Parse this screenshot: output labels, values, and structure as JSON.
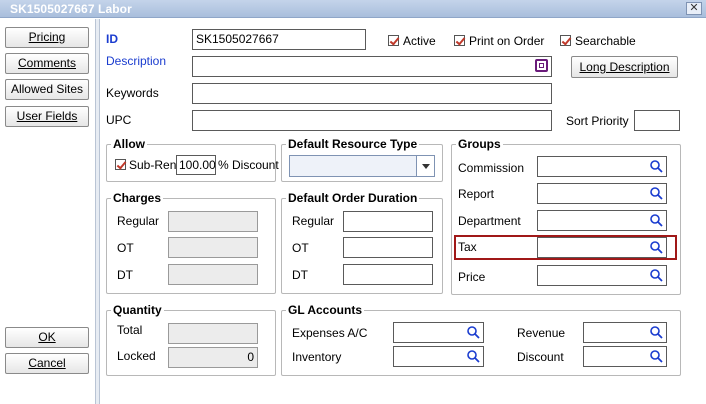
{
  "window": {
    "title": "SK1505027667 Labor",
    "close_glyph": "✕"
  },
  "sidebar": {
    "pricing": "Pricing",
    "comments": "Comments",
    "allowed_sites": "Allowed Sites",
    "user_fields": "User Fields",
    "ok": "OK",
    "cancel": "Cancel"
  },
  "header": {
    "id_label": "ID",
    "id_value": "SK1505027667",
    "active_label": "Active",
    "print_on_order_label": "Print on Order",
    "searchable_label": "Searchable",
    "description_label": "Description",
    "description_value": "",
    "long_description_button": "Long Description",
    "keywords_label": "Keywords",
    "upc_label": "UPC",
    "sort_priority_label": "Sort Priority"
  },
  "allow": {
    "title": "Allow",
    "sub_rent_label": "Sub-Rent",
    "discount_value": "100.00",
    "discount_label": "% Discount"
  },
  "default_resource_type": {
    "title": "Default Resource Type",
    "value": ""
  },
  "groups": {
    "title": "Groups",
    "commission": "Commission",
    "report": "Report",
    "department": "Department",
    "tax": "Tax",
    "price": "Price"
  },
  "charges": {
    "title": "Charges",
    "regular": "Regular",
    "ot": "OT",
    "dt": "DT"
  },
  "default_order_duration": {
    "title": "Default Order Duration",
    "regular": "Regular",
    "ot": "OT",
    "dt": "DT"
  },
  "quantity": {
    "title": "Quantity",
    "total_label": "Total",
    "locked_label": "Locked",
    "locked_value": "0"
  },
  "gl_accounts": {
    "title": "GL Accounts",
    "expenses": "Expenses A/C",
    "inventory": "Inventory",
    "revenue": "Revenue",
    "discount": "Discount"
  },
  "colors": {
    "label_blue": "#1a3ccf",
    "highlight": "#a01818",
    "search_icon": "#1a3ccf"
  }
}
